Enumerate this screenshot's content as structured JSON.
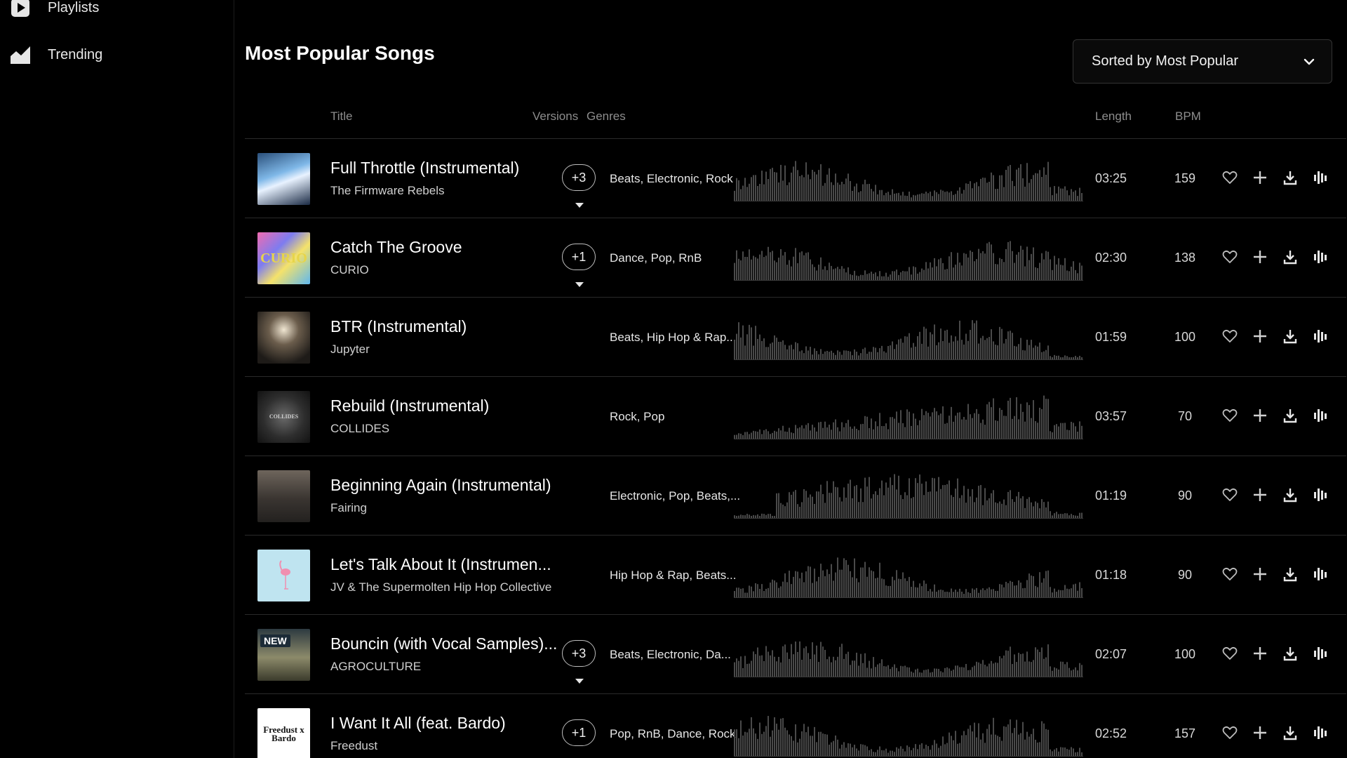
{
  "sidebar": {
    "items": [
      {
        "label": "Playlists",
        "icon": "play-icon"
      },
      {
        "label": "Trending",
        "icon": "trending-icon"
      }
    ]
  },
  "main": {
    "title": "Most Popular Songs",
    "sort": {
      "label": "Sorted by Most Popular"
    },
    "columns": {
      "title": "Title",
      "versions": "Versions",
      "genres": "Genres",
      "length": "Length",
      "bpm": "BPM"
    }
  },
  "colors": {
    "background": "#000000",
    "waveform": "#4a4a4a",
    "divider": "#2a2a2a",
    "muted_text": "#8d8d8d"
  },
  "songs": [
    {
      "title": "Full Throttle (Instrumental)",
      "artist": "The Firmware Rebels",
      "versions": "+3",
      "genres": "Beats, Electronic, Rock",
      "length": "03:25",
      "bpm": "159",
      "thumb_text": "",
      "badge": ""
    },
    {
      "title": "Catch The Groove",
      "artist": "CURIO",
      "versions": "+1",
      "genres": "Dance, Pop, RnB",
      "length": "02:30",
      "bpm": "138",
      "thumb_text": "CURIO",
      "badge": ""
    },
    {
      "title": "BTR (Instrumental)",
      "artist": "Jupyter",
      "versions": "",
      "genres": "Beats, Hip Hop & Rap...",
      "length": "01:59",
      "bpm": "100",
      "thumb_text": "",
      "badge": ""
    },
    {
      "title": "Rebuild (Instrumental)",
      "artist": "COLLIDES",
      "versions": "",
      "genres": "Rock, Pop",
      "length": "03:57",
      "bpm": "70",
      "thumb_text": "COLLIDES",
      "badge": ""
    },
    {
      "title": "Beginning Again (Instrumental)",
      "artist": "Fairing",
      "versions": "",
      "genres": "Electronic, Pop, Beats,...",
      "length": "01:19",
      "bpm": "90",
      "thumb_text": "",
      "badge": ""
    },
    {
      "title": "Let's Talk About It (Instrumen...",
      "artist": "JV & The Supermolten Hip Hop Collective",
      "versions": "",
      "genres": "Hip Hop & Rap, Beats...",
      "length": "01:18",
      "bpm": "90",
      "thumb_text": "",
      "badge": ""
    },
    {
      "title": "Bouncin (with Vocal Samples)...",
      "artist": "AGROCULTURE",
      "versions": "+3",
      "genres": "Beats, Electronic, Da...",
      "length": "02:07",
      "bpm": "100",
      "thumb_text": "",
      "badge": "NEW"
    },
    {
      "title": "I Want It All (feat. Bardo)",
      "artist": "Freedust",
      "versions": "+1",
      "genres": "Pop, RnB, Dance, Rock",
      "length": "02:52",
      "bpm": "157",
      "thumb_text": "Freedust x Bardo",
      "badge": ""
    }
  ]
}
